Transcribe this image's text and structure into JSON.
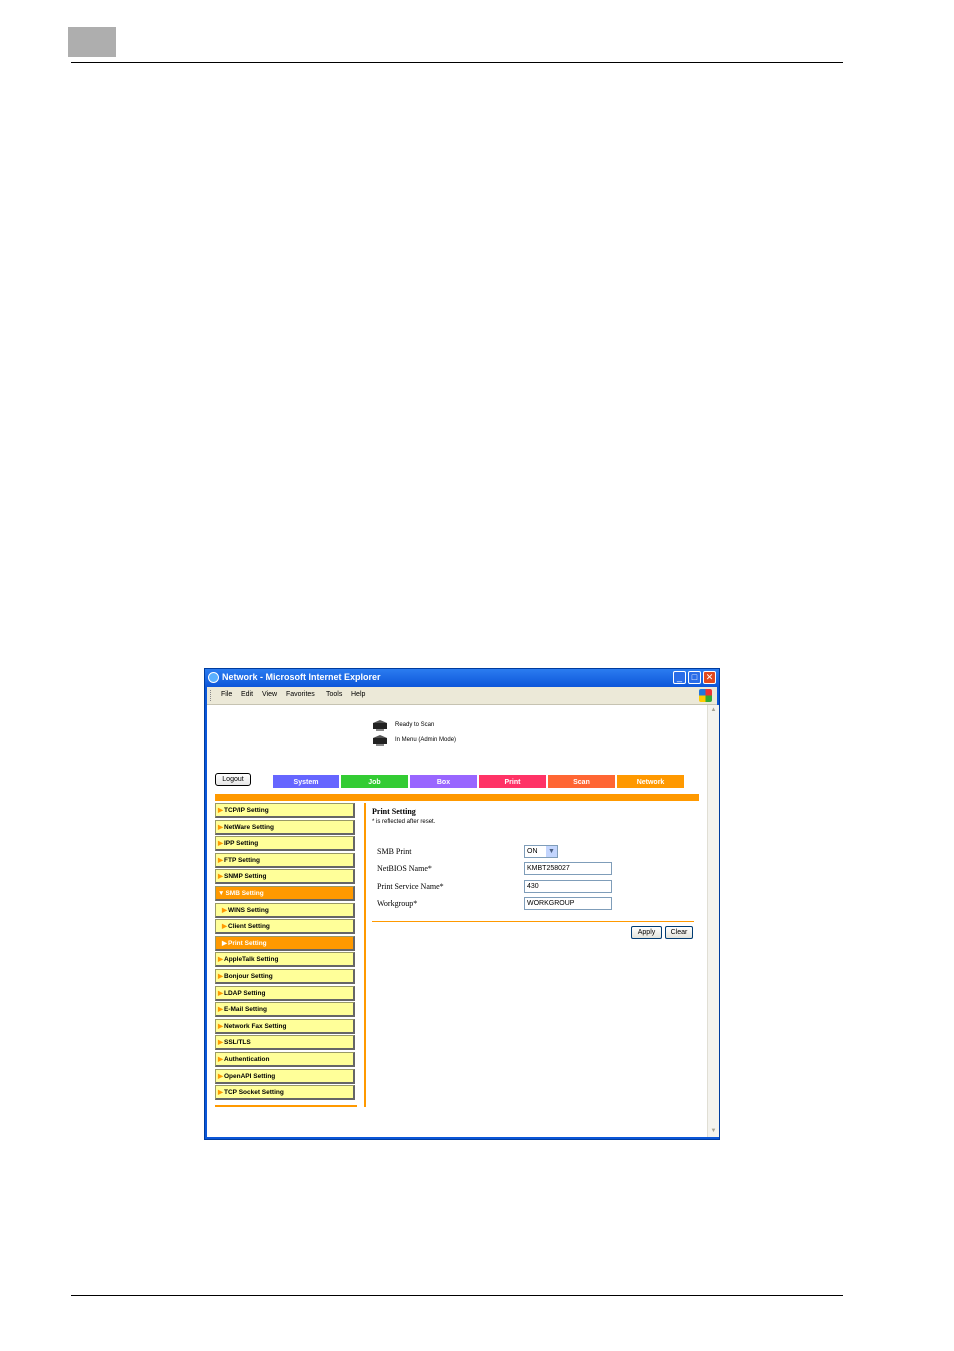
{
  "window": {
    "title": "Network - Microsoft Internet Explorer"
  },
  "menu": [
    "File",
    "Edit",
    "View",
    "Favorites",
    "Tools",
    "Help"
  ],
  "status": {
    "line1": "Ready to Scan",
    "line2": "In Menu (Admin Mode)"
  },
  "logout_label": "Logout",
  "tabs": [
    {
      "label": "System",
      "color": "#6666ff"
    },
    {
      "label": "Job",
      "color": "#33cc33"
    },
    {
      "label": "Box",
      "color": "#9966ff"
    },
    {
      "label": "Print",
      "color": "#ff3366"
    },
    {
      "label": "Scan",
      "color": "#ff6633"
    },
    {
      "label": "Network",
      "color": "#ff9900"
    }
  ],
  "sidebar": [
    {
      "label": "TCP/IP Setting"
    },
    {
      "label": "NetWare Setting"
    },
    {
      "label": "IPP Setting"
    },
    {
      "label": "FTP Setting"
    },
    {
      "label": "SNMP Setting"
    },
    {
      "label": "SMB Setting",
      "expanded": true
    },
    {
      "label": "WINS Setting",
      "sub": true
    },
    {
      "label": "Client Setting",
      "sub": true
    },
    {
      "label": "Print Setting",
      "sub": true,
      "active": true
    },
    {
      "label": "AppleTalk Setting"
    },
    {
      "label": "Bonjour Setting"
    },
    {
      "label": "LDAP Setting"
    },
    {
      "label": "E-Mail Setting"
    },
    {
      "label": "Network Fax Setting"
    },
    {
      "label": "SSL/TLS"
    },
    {
      "label": "Authentication"
    },
    {
      "label": "OpenAPI Setting"
    },
    {
      "label": "TCP Socket Setting"
    }
  ],
  "main": {
    "title": "Print Setting",
    "note": "* is reflected after reset.",
    "smb_print_label": "SMB Print",
    "smb_print_value": "ON",
    "netbios_label": "NetBIOS Name*",
    "netbios_value": "KMBT258027",
    "service_label": "Print Service Name*",
    "service_value": "430",
    "workgroup_label": "Workgroup*",
    "workgroup_value": "WORKGROUP",
    "apply_label": "Apply",
    "clear_label": "Clear"
  },
  "colors": {
    "accent": "#ff9900",
    "sidebar_bg": "#ffff99"
  }
}
